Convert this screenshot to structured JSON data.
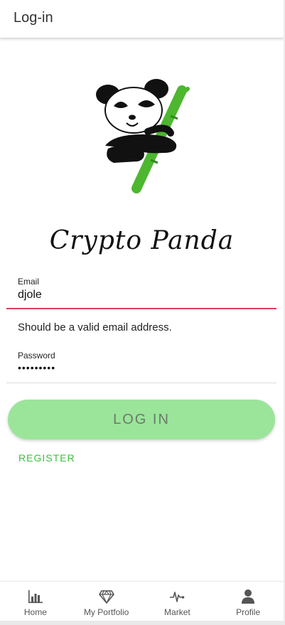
{
  "header": {
    "title": "Log-in"
  },
  "brand": {
    "name": "Crypto Panda",
    "logo_icon": "panda-bamboo-logo"
  },
  "form": {
    "email": {
      "label": "Email",
      "value": "djole",
      "error": "Should be a valid email address.",
      "underline_color": "#d9415a"
    },
    "password": {
      "label": "Password",
      "value": "•••••••••"
    },
    "login_label": "LOG IN",
    "register_label": "REGISTER"
  },
  "colors": {
    "accent_green": "#3cc13c",
    "button_green": "#9be59a",
    "error": "#d9415a"
  },
  "bottom_nav": {
    "items": [
      {
        "label": "Home",
        "icon": "bar-chart-icon"
      },
      {
        "label": "My Portfolio",
        "icon": "diamond-icon"
      },
      {
        "label": "Market",
        "icon": "pulse-icon"
      },
      {
        "label": "Profile",
        "icon": "person-icon"
      }
    ]
  }
}
